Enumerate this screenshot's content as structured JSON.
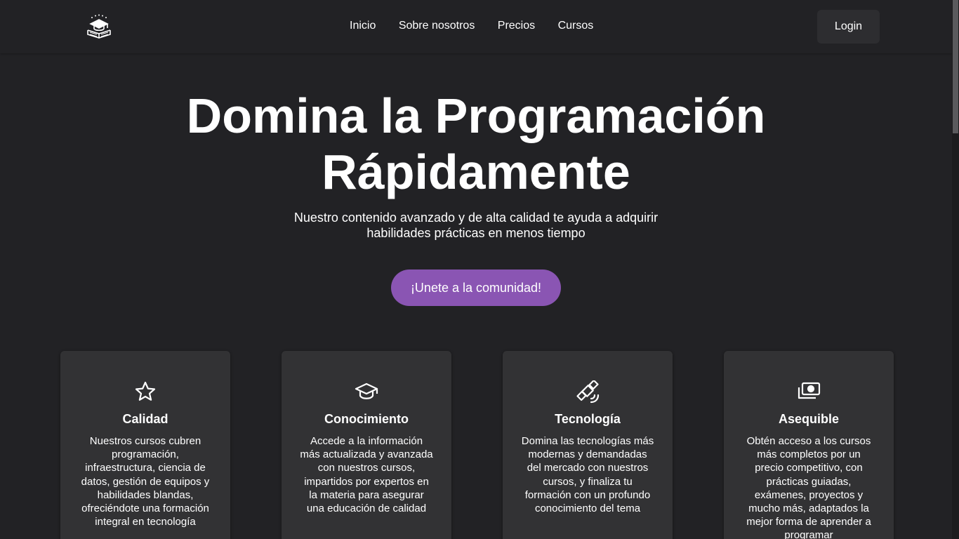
{
  "top_progress": {
    "percent": 20
  },
  "header": {
    "logo_icon": "graduation-cap-book-icon",
    "nav": [
      "Inicio",
      "Sobre nosotros",
      "Precios",
      "Cursos"
    ],
    "login_label": "Login"
  },
  "hero": {
    "title_line1": "Domina la Programación",
    "title_line2": "Rápidamente",
    "subtitle_line1": "Nuestro contenido avanzado y de alta calidad te ayuda a adquirir",
    "subtitle_line2": "habilidades prácticas en menos tiempo",
    "cta_label": "¡Unete a la comunidad!",
    "cta_color": "#8a55b3"
  },
  "features": [
    {
      "icon": "star-icon",
      "title": "Calidad",
      "text": "Nuestros cursos cubren programación, infraestructura, ciencia de datos, gestión de equipos y habilidades blandas, ofreciéndote una formación integral en tecnología"
    },
    {
      "icon": "graduation-cap-icon",
      "title": "Conocimiento",
      "text": "Accede a la información más actualizada y avanzada con nuestros cursos, impartidos por expertos en la materia para asegurar una educación de calidad"
    },
    {
      "icon": "satellite-icon",
      "title": "Tecnología",
      "text": "Domina las tecnologías más modernas y demandadas del mercado con nuestros cursos, y finaliza tu formación con un profundo conocimiento del tema"
    },
    {
      "icon": "money-icon",
      "title": "Asequible",
      "text": "Obtén acceso a los cursos más completos por un precio competitivo, con prácticas guiadas, exámenes, proyectos y mucho más, adaptados la mejor forma de aprender a programar"
    }
  ],
  "colors": {
    "background": "#222225",
    "card": "#323234",
    "text": "#ffffff",
    "accent": "#8a55b3"
  }
}
